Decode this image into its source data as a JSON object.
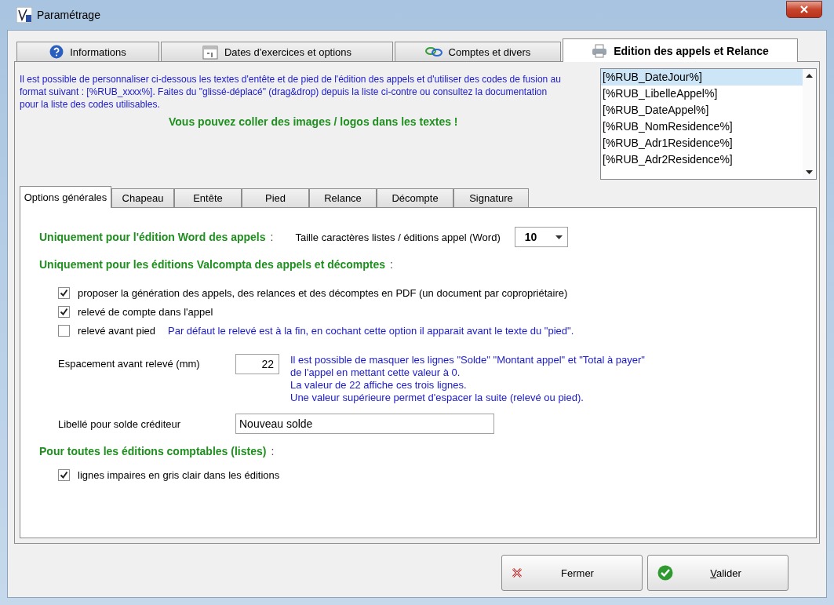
{
  "window": {
    "title": "Paramétrage"
  },
  "top_tabs": [
    {
      "label": "Informations",
      "selected": false
    },
    {
      "label": "Dates d'exercices et options",
      "selected": false
    },
    {
      "label": "Comptes et divers",
      "selected": false
    },
    {
      "label": "Edition des appels et Relance",
      "selected": true
    }
  ],
  "intro": {
    "text": "Il est possible de personnaliser ci-dessous les textes d'entête et de pied de l'édition des appels et d'utiliser des codes de fusion au format suivant : [%RUB_xxxx%]. Faites du \"glissé-déplacé\" (drag&drop) depuis la liste ci-contre ou consultez la documentation pour la liste des codes utilisables.",
    "note": "Vous pouvez coller des images / logos dans les textes !"
  },
  "merge_codes": [
    {
      "label": "[%RUB_DateJour%]",
      "selected": true
    },
    {
      "label": "[%RUB_LibelleAppel%]",
      "selected": false
    },
    {
      "label": "[%RUB_DateAppel%]",
      "selected": false
    },
    {
      "label": "[%RUB_NomResidence%]",
      "selected": false
    },
    {
      "label": "[%RUB_Adr1Residence%]",
      "selected": false
    },
    {
      "label": "[%RUB_Adr2Residence%]",
      "selected": false
    }
  ],
  "inner_tabs": [
    {
      "label": "Options générales",
      "selected": true
    },
    {
      "label": "Chapeau",
      "selected": false
    },
    {
      "label": "Entête",
      "selected": false
    },
    {
      "label": "Pied",
      "selected": false
    },
    {
      "label": "Relance",
      "selected": false
    },
    {
      "label": "Décompte",
      "selected": false
    },
    {
      "label": "Signature",
      "selected": false
    }
  ],
  "word_section": {
    "heading": "Uniquement pour l'édition Word des appels",
    "suffix": ":",
    "font_size_label": "Taille caractères listes / éditions appel (Word)",
    "font_size_value": "10"
  },
  "valcompta_section": {
    "heading": "Uniquement pour les éditions Valcompta des appels et décomptes",
    "suffix": ":",
    "options": [
      {
        "label": "proposer la génération des appels, des relances et des décomptes en PDF (un document par copropriétaire)",
        "checked": true
      },
      {
        "label": "relevé de compte dans l'appel",
        "checked": true
      },
      {
        "label": "relevé avant pied",
        "checked": false,
        "note": "Par défaut le relevé est à la fin, en cochant cette option il apparait avant le texte du \"pied\"."
      }
    ]
  },
  "spacing": {
    "label": "Espacement avant relevé (mm)",
    "value": "22",
    "note_lines": [
      "Il est possible de masquer les lignes \"Solde\" \"Montant appel\" et \"Total à payer\"",
      "de l'appel en mettant cette valeur à 0.",
      "La valeur de 22 affiche ces trois lignes.",
      "Une valeur supérieure permet d'espacer la suite (relevé ou pied)."
    ]
  },
  "credit_label": {
    "label": "Libellé pour solde créditeur",
    "value": "Nouveau solde"
  },
  "accounting_section": {
    "heading": "Pour toutes les éditions comptables (listes)",
    "suffix": ":",
    "options": [
      {
        "label": "lignes impaires en gris clair dans les éditions",
        "checked": true
      }
    ]
  },
  "buttons": [
    {
      "label": "Fermer",
      "kind": "close"
    },
    {
      "label": "Valider",
      "kind": "confirm"
    }
  ]
}
